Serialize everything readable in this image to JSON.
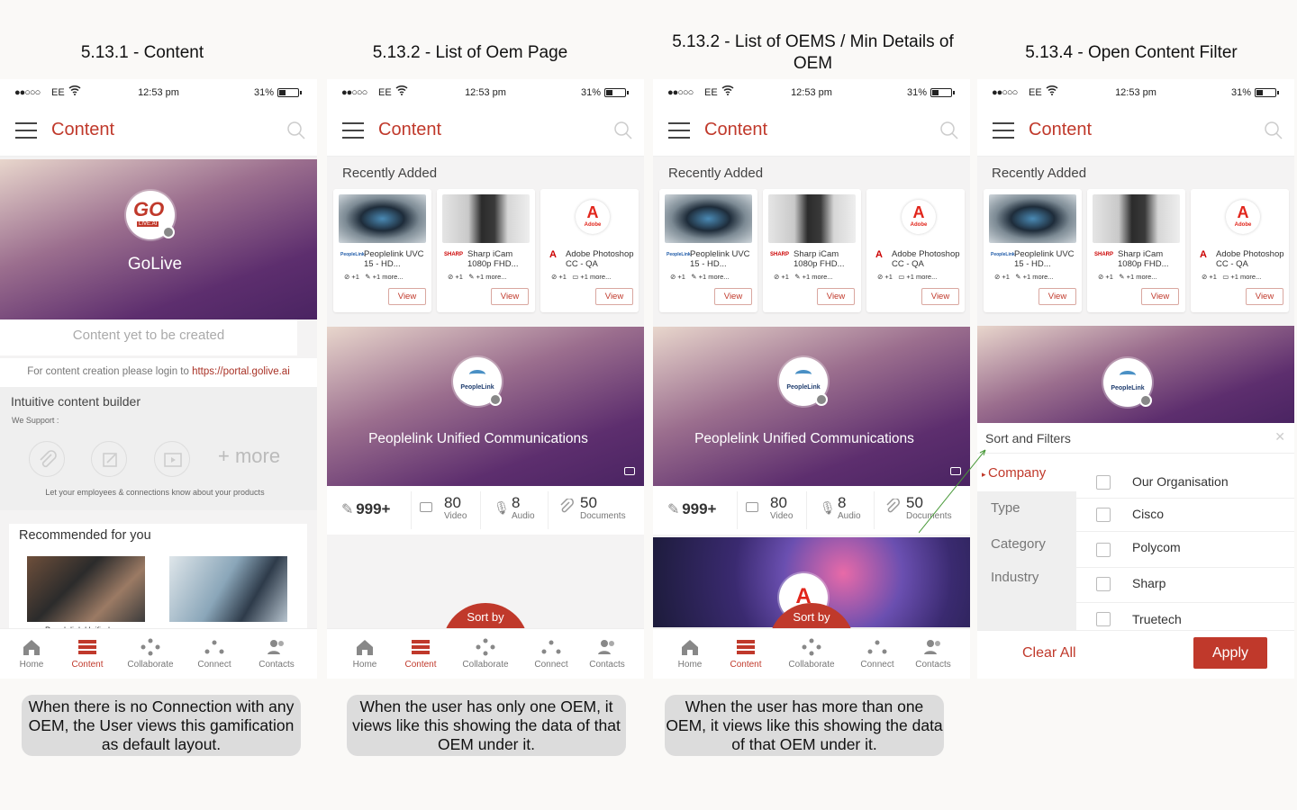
{
  "columns": [
    {
      "title": "5.13.1 - Content"
    },
    {
      "title": "5.13.2 - List of Oem Page"
    },
    {
      "title": "5.13.2 - List of OEMS / Min Details of OEM"
    },
    {
      "title": "5.13.4 - Open Content Filter"
    }
  ],
  "status": {
    "carrier": "EE",
    "time": "12:53 pm",
    "battery": "31%",
    "signal": "●●○○○"
  },
  "appbar": {
    "title": "Content"
  },
  "nav": [
    {
      "label": "Home"
    },
    {
      "label": "Content"
    },
    {
      "label": "Collaborate"
    },
    {
      "label": "Connect"
    },
    {
      "label": "Contacts"
    }
  ],
  "screen1": {
    "brand_name": "GoLive",
    "logo_text": "GO",
    "logo_sub": "LIVE.AI",
    "empty_text": "Content yet to be created",
    "login_text": "For content creation please login to ",
    "login_link": "https://portal.golive.ai",
    "builder_title": "Intuitive content builder",
    "we_support": "We Support :",
    "more": "+ more",
    "employees_text": "Let your employees & connections know about your products",
    "recommended": "Recommended for you",
    "rec1_caption": "Peoplelink Unified"
  },
  "recent": {
    "title": "Recently Added",
    "cards": [
      {
        "title": "Peoplelink UVC 15 - HD...",
        "brand": "PeopleLink",
        "plus": "+1",
        "more": "+1 more...",
        "view": "View"
      },
      {
        "title": "Sharp iCam 1080p FHD...",
        "brand": "SHARP",
        "plus": "+1",
        "more": "+1 more...",
        "view": "View"
      },
      {
        "title": "Adobe Photoshop CC - QA",
        "brand": "Adobe",
        "plus": "+1",
        "more": "+1 more...",
        "view": "View"
      }
    ]
  },
  "oem": {
    "name": "Peoplelink Unified Communications",
    "logo_text": "PeopleLink",
    "adobe_text": "Adobe",
    "stats": {
      "total": "999+",
      "video": "80",
      "video_label": "Video",
      "audio": "8",
      "audio_label": "Audio",
      "docs": "50",
      "docs_label": "Documents"
    }
  },
  "sort_label": "Sort by",
  "filter": {
    "title": "Sort and Filters",
    "categories": [
      "Company",
      "Type",
      "Category",
      "Industry"
    ],
    "options": [
      "Our Organisation",
      "Cisco",
      "Polycom",
      "Sharp",
      "Truetech"
    ],
    "clear": "Clear All",
    "apply": "Apply"
  },
  "captions": [
    "When there is no Connection with any OEM, the User views this gamification as default layout.",
    "When the user has only one OEM, it views like this showing the data of that OEM under it.",
    "When the user has more than one OEM, it views like this showing the data of that OEM under it."
  ],
  "colors": {
    "accent": "#c0392b",
    "banner_dark": "#4a2462",
    "banner_light": "#e8d6cc"
  }
}
